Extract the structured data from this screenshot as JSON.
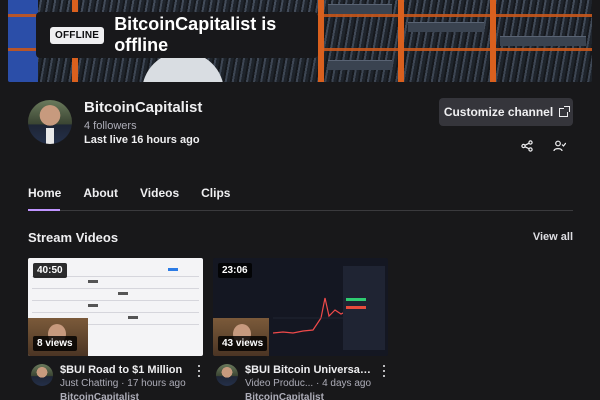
{
  "banner": {
    "badge": "OFFLINE",
    "offline_text": "BitcoinCapitalist is offline"
  },
  "channel": {
    "name": "BitcoinCapitalist",
    "followers": "4 followers",
    "last_live": "Last live 16 hours ago",
    "customize_label": "Customize channel"
  },
  "tabs": [
    {
      "label": "Home",
      "active": true
    },
    {
      "label": "About",
      "active": false
    },
    {
      "label": "Videos",
      "active": false
    },
    {
      "label": "Clips",
      "active": false
    }
  ],
  "section": {
    "title": "Stream Videos",
    "view_all": "View all"
  },
  "videos": [
    {
      "duration": "40:50",
      "views": "8 views",
      "title": "$BUI Road to $1 Million",
      "subtitle": "Just Chatting · 17 hours ago",
      "channel": "BitcoinCapitalist"
    },
    {
      "duration": "23:06",
      "views": "43 views",
      "title": "$BUI Bitcoin Universal ...",
      "subtitle": "Video Produc... · 4 days ago",
      "channel": "BitcoinCapitalist"
    }
  ],
  "colors": {
    "background": "#18181a",
    "accent": "#bf94ff",
    "button_bg": "#35353b"
  },
  "icons": [
    "external-link-icon",
    "share-icon",
    "follow-user-icon",
    "kebab-menu-icon"
  ]
}
